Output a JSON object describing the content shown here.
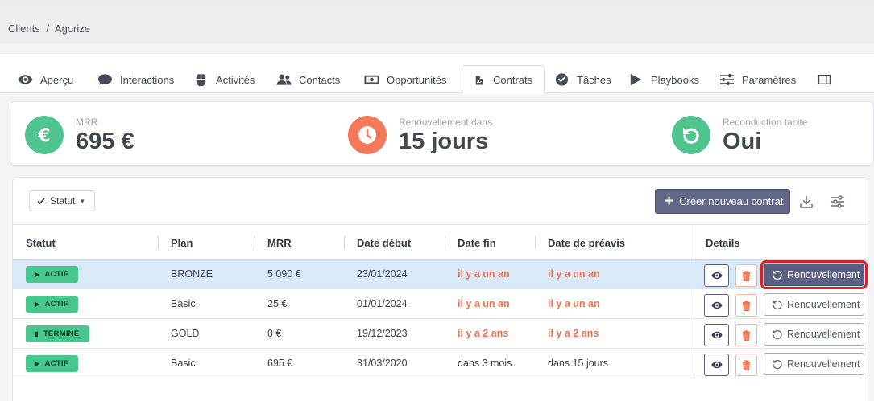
{
  "breadcrumb": {
    "items": [
      "Clients",
      "/",
      "Agorize"
    ]
  },
  "tabs": [
    {
      "label": "Aperçu",
      "icon": "eye-icon"
    },
    {
      "label": "Interactions",
      "icon": "chat-bubble-icon"
    },
    {
      "label": "Activités",
      "icon": "mouse-icon"
    },
    {
      "label": "Contacts",
      "icon": "users-icon"
    },
    {
      "label": "Opportunités",
      "icon": "money-bill-icon"
    },
    {
      "label": "Contrats",
      "icon": "contract-file-icon",
      "active": true
    },
    {
      "label": "Tâches",
      "icon": "check-circle-icon"
    },
    {
      "label": "Playbooks",
      "icon": "play-icon"
    },
    {
      "label": "Paramètres",
      "icon": "sliders-icon"
    },
    {
      "label": "",
      "icon": "sidebar-toggle-icon"
    }
  ],
  "kpis": [
    {
      "label": "MRR",
      "value": "695 €",
      "icon": "euro-icon",
      "color": "#4fc48e"
    },
    {
      "label": "Renouvellement dans",
      "value": "15 jours",
      "icon": "clock-icon",
      "color": "#f4795a"
    },
    {
      "label": "Reconduction tacite",
      "value": "Oui",
      "icon": "renew-arrow-icon",
      "color": "#4fc48e"
    }
  ],
  "toolbar": {
    "filter_label": "Statut",
    "create_label": "Créer nouveau contrat"
  },
  "table": {
    "headers": [
      "Statut",
      "Plan",
      "MRR",
      "Date début",
      "Date fin",
      "Date de préavis",
      "Details"
    ],
    "rows": [
      {
        "statut": "ACTIF",
        "plan": "BRONZE",
        "mrr": "5 090 €",
        "debut": "23/01/2024",
        "fin": "il y a un an",
        "preavis": "il y a un an",
        "selected": true
      },
      {
        "statut": "ACTIF",
        "plan": "Basic",
        "mrr": "25 €",
        "debut": "01/01/2024",
        "fin": "il y a un an",
        "preavis": "il y a un an"
      },
      {
        "statut": "TERMINÉ",
        "plan": "GOLD",
        "mrr": "0 €",
        "debut": "19/12/2023",
        "fin": "il y a 2 ans",
        "preavis": "il y a 2 ans"
      },
      {
        "statut": "ACTIF",
        "plan": "Basic",
        "mrr": "695 €",
        "debut": "31/03/2020",
        "fin": "dans 3 mois",
        "preavis": "dans 15 jours"
      }
    ],
    "renew_label": "Renouvellement"
  },
  "colors": {
    "accent": "#5a5e80",
    "danger": "#f2714b",
    "success": "#47c78d",
    "highlight": "#e11e1e"
  }
}
